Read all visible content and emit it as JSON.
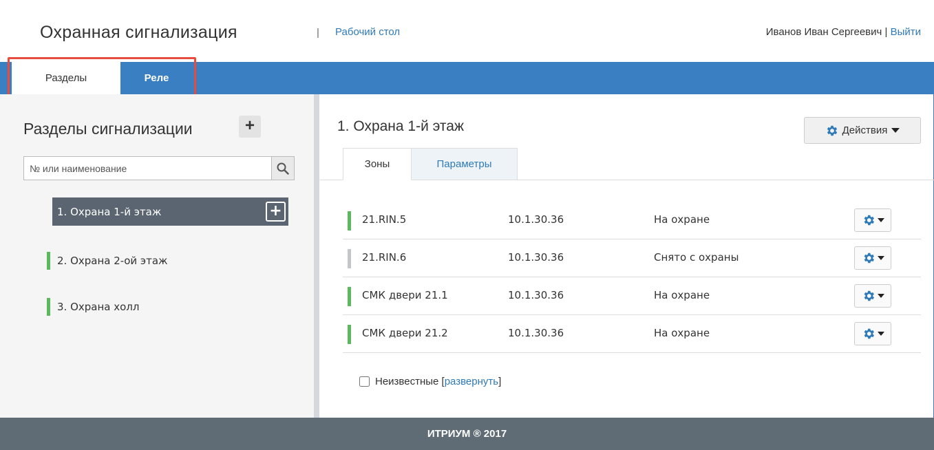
{
  "header": {
    "app_title": "Охранная сигнализация",
    "separator": "|",
    "desktop_link": "Рабочий стол",
    "user_name": "Иванов Иван Сергеевич",
    "user_sep": " | ",
    "logout": "Выйти"
  },
  "nav": {
    "tabs": [
      {
        "label": "Разделы",
        "active": true
      },
      {
        "label": "Реле",
        "active": false
      }
    ],
    "accent_color": "#3a7fc1",
    "highlight_color": "#e74c3c"
  },
  "sections_panel": {
    "heading": "Разделы сигнализации",
    "add_icon": "plus-icon",
    "search": {
      "placeholder": "№ или наименование",
      "value": "",
      "icon": "search-icon"
    },
    "items": [
      {
        "label": "1. Охрана 1-й этаж",
        "selected": true
      },
      {
        "label": "2. Охрана 2-ой этаж",
        "status": "green"
      },
      {
        "label": "3. Охрана холл",
        "status": "green"
      }
    ]
  },
  "detail": {
    "title": "1. Охрана 1-й этаж",
    "actions_label": "Действия",
    "actions_icon": "gear-icon",
    "tabs": [
      {
        "label": "Зоны",
        "active": true
      },
      {
        "label": "Параметры",
        "active": false
      }
    ],
    "zones": [
      {
        "name": "21.RIN.5",
        "ip": "10.1.30.36",
        "state": "На охране",
        "status": "green"
      },
      {
        "name": "21.RIN.6",
        "ip": "10.1.30.36",
        "state": "Снято с охраны",
        "status": "grey"
      },
      {
        "name": "СМК двери 21.1",
        "ip": "10.1.30.36",
        "state": "На охране",
        "status": "green"
      },
      {
        "name": "СМК двери 21.2",
        "ip": "10.1.30.36",
        "state": "На охране",
        "status": "green"
      }
    ],
    "unknown_label": "Неизвестные",
    "expand_label": "развернуть",
    "unknown_checked": false
  },
  "footer": {
    "text": "ИТРИУМ ® 2017"
  },
  "colors": {
    "green": "#5cb85c",
    "grey": "#c2c6cb",
    "link": "#2f7ab8",
    "footer_bg": "#5f6b75",
    "gear": "#2f7ab8"
  }
}
